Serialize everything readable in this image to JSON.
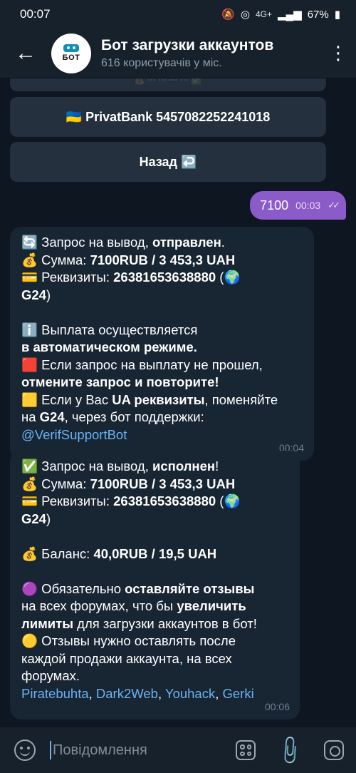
{
  "status_bar": {
    "time": "00:07",
    "network": "4G+",
    "battery": "67%"
  },
  "header": {
    "back_icon": "←",
    "avatar_text": "БОТ",
    "title": "Бот загрузки аккаунтов",
    "subtitle": "616 користувачів у міс.",
    "menu_icon": "⋮"
  },
  "keyboard": {
    "partial_label": "💰 ··· ··· ··· ··· ✅",
    "bank_button": "🇺🇦 PrivatBank 5457082252241018",
    "back_button": "Назад ↩️"
  },
  "outgoing": {
    "text": "7100",
    "time": "00:03",
    "checks": "✓✓"
  },
  "message1": {
    "l1a": "🔄 Запрос на вывод, ",
    "l1b": "отправлен",
    "l1c": ".",
    "l2a": "💰 Сумма: ",
    "l2b": "7100RUB  / 3 453,3 UAH",
    "l3a": "💳 Реквизиты: ",
    "l3b": "26381653638880",
    "l3c": " (🌍",
    "l4": "G24",
    "l4c": ")",
    "l5": "ℹ️ Выплата осуществляется",
    "l6": "в автоматическом режиме.",
    "l7": "🟥 Если запрос на выплату не прошел,",
    "l8": "отмените запрос и повторите!",
    "l9a": "🟨 Если у Вас ",
    "l9b": "UA реквизиты",
    "l9c": ", поменяйте",
    "l10a": "на ",
    "l10b": "G24",
    "l10c": ", через бот поддержки:",
    "l11": "@VerifSupportBot",
    "time": "00:04"
  },
  "message2": {
    "l1a": "✅ Запрос на вывод, ",
    "l1b": "исполнен",
    "l1c": "!",
    "l2a": "💰 Сумма: ",
    "l2b": "7100RUB  / 3 453,3 UAH",
    "l3a": "💳 Реквизиты: ",
    "l3b": "26381653638880",
    "l3c": " (🌍",
    "l4": "G24",
    "l4c": ")",
    "l5a": "💰 Баланс: ",
    "l5b": "40,0RUB  / 19,5 UAH",
    "l6a": "🟣 Обязательно ",
    "l6b": "оставляйте отзывы",
    "l7a": "на всех форумах, что бы ",
    "l7b": "увеличить",
    "l8a": "лимиты",
    "l8b": " для загрузки аккаунтов в бот!",
    "l9": "🟡 Отзывы нужно оставлять после",
    "l10": "каждой продажи аккаунта, на всех",
    "l11": "форумах.",
    "links": [
      "Piratebuhta",
      "Dark2Web",
      "Youhack",
      "Gerki"
    ],
    "sep": ", ",
    "time": "00:06"
  },
  "composer": {
    "placeholder": "Повідомлення"
  }
}
